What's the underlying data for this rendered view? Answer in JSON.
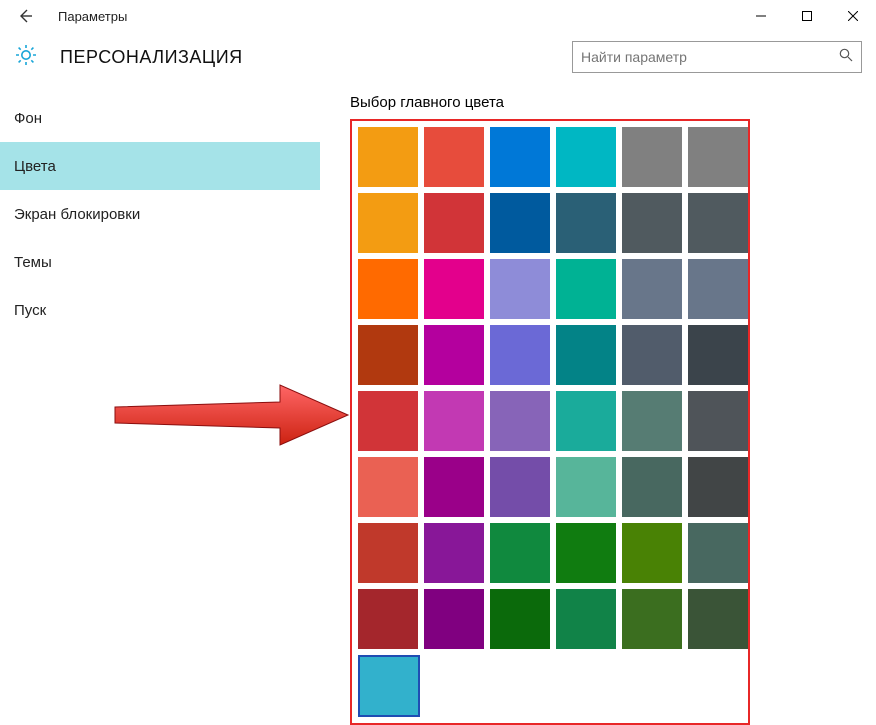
{
  "window": {
    "title": "Параметры"
  },
  "header": {
    "page_title": "ПЕРСОНАЛИЗАЦИЯ",
    "search_placeholder": "Найти параметр"
  },
  "sidebar": {
    "items": [
      {
        "label": "Фон",
        "selected": false
      },
      {
        "label": "Цвета",
        "selected": true
      },
      {
        "label": "Экран блокировки",
        "selected": false
      },
      {
        "label": "Темы",
        "selected": false
      },
      {
        "label": "Пуск",
        "selected": false
      }
    ]
  },
  "content": {
    "section_title": "Выбор главного цвета",
    "selected_index": 48,
    "colors": [
      "#f39c12",
      "#e74c3c",
      "#0078d7",
      "#00b7c3",
      "#808080",
      "#808080",
      "#f39c12",
      "#d13438",
      "#005a9e",
      "#2a6076",
      "#505a5f",
      "#505a5f",
      "#ff6a00",
      "#e3008c",
      "#8e8cd8",
      "#00b294",
      "#68768a",
      "#68768a",
      "#b1390f",
      "#b4009e",
      "#6b69d6",
      "#038387",
      "#515c6b",
      "#3b444b",
      "#d13438",
      "#c239b3",
      "#8764b8",
      "#1aab9b",
      "#567c73",
      "#4f5459",
      "#ea6153",
      "#9a0089",
      "#744da9",
      "#57b59a",
      "#486860",
      "#414546",
      "#c0392b",
      "#881798",
      "#10893e",
      "#107c10",
      "#498205",
      "#486860",
      "#a4262c",
      "#800080",
      "#0b6a0b",
      "#118348",
      "#3b6e1f",
      "#3a5437",
      "#32b1cc"
    ]
  }
}
